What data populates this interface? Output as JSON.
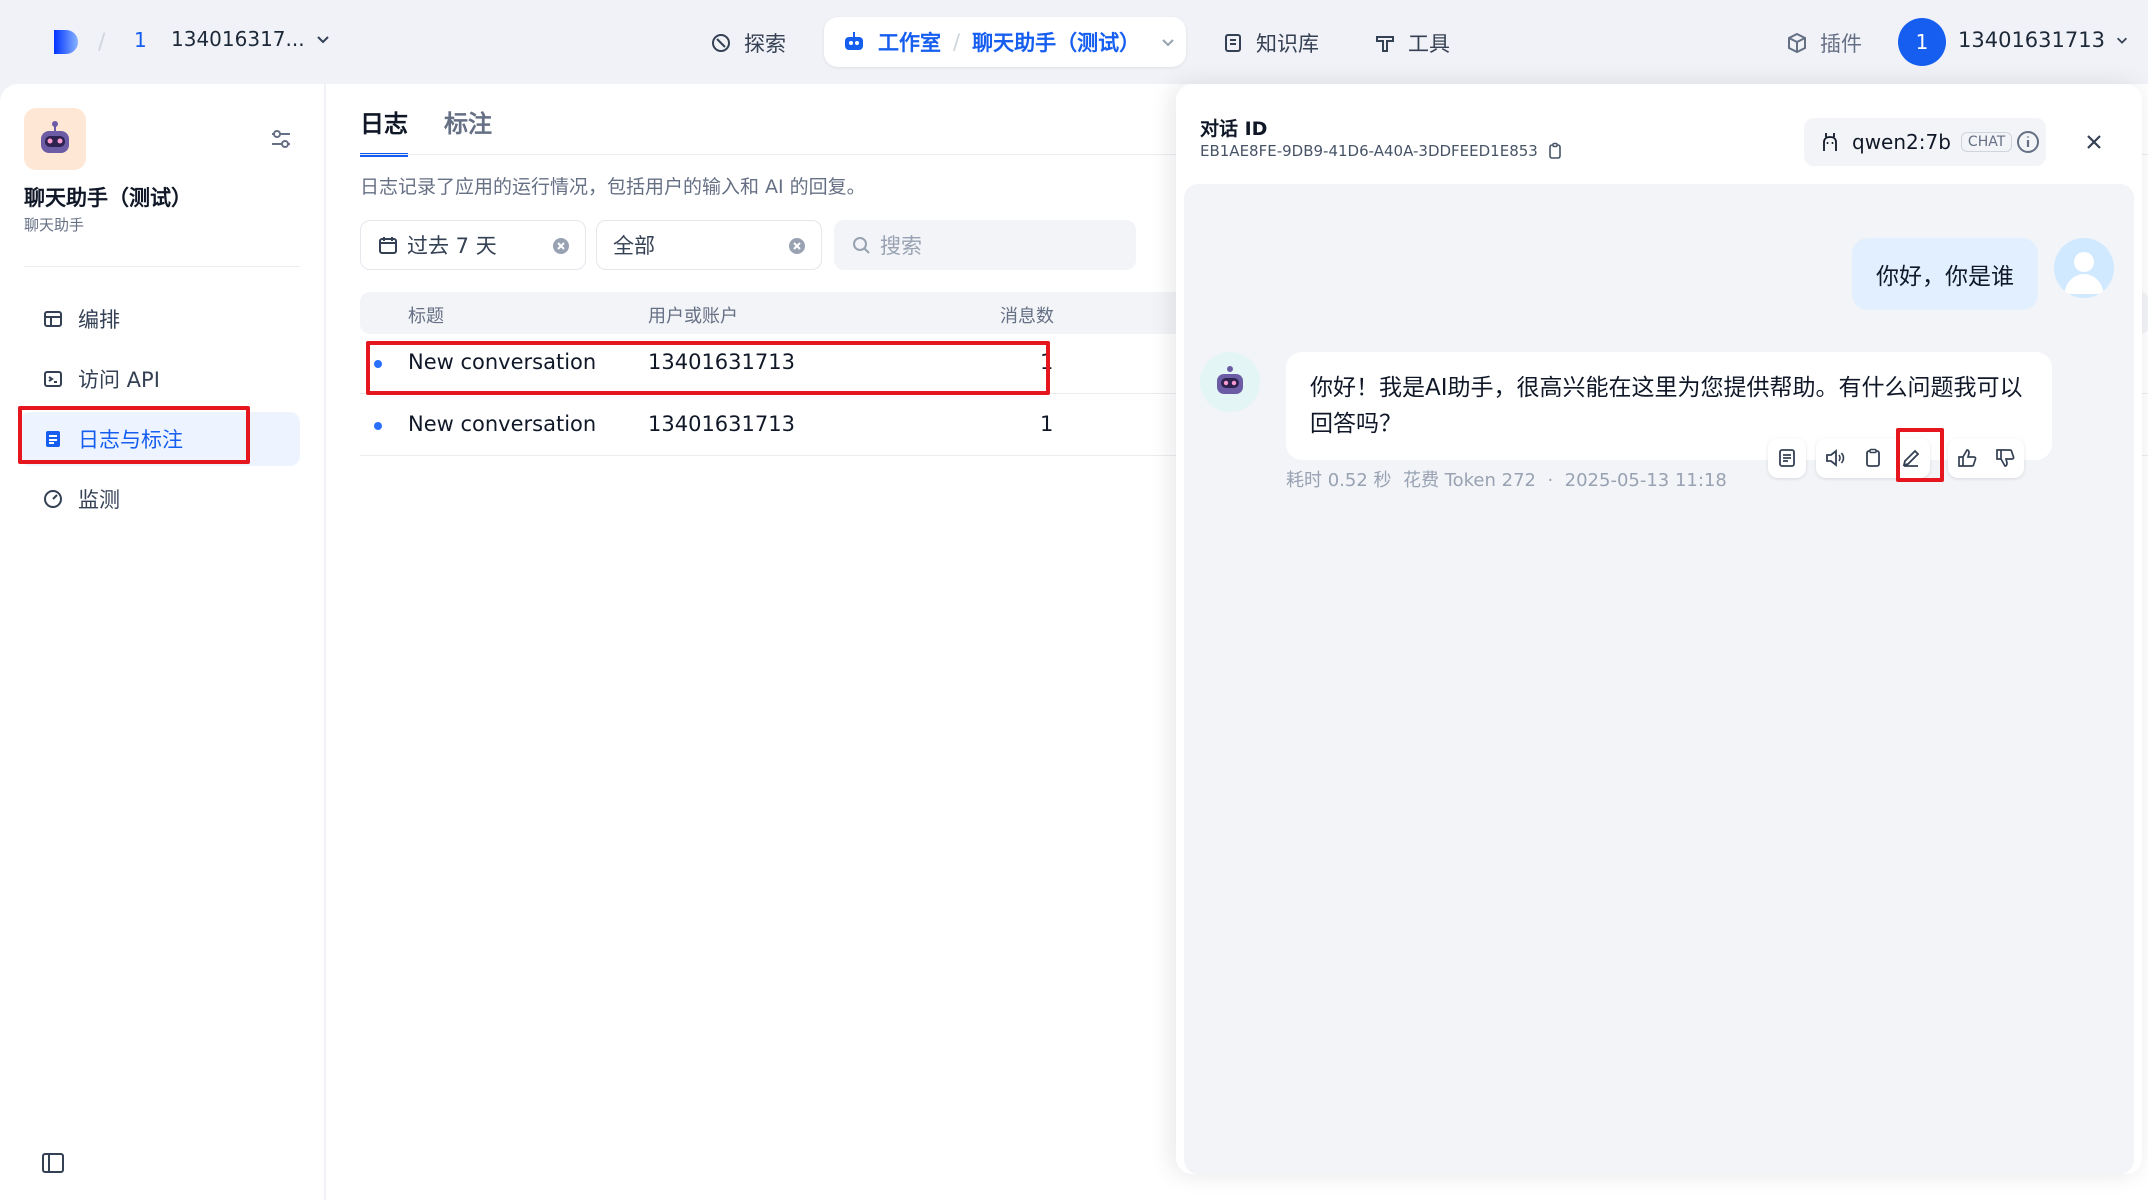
{
  "topbar": {
    "workspace_badge": "1",
    "workspace_name": "134016317...",
    "nav_explore": "探索",
    "nav_studio": "工作室",
    "nav_app": "聊天助手（测试）",
    "nav_knowledge": "知识库",
    "nav_tools": "工具",
    "nav_plugins": "插件",
    "user_avatar": "1",
    "user_name": "13401631713"
  },
  "sidebar": {
    "app_title": "聊天助手（测试）",
    "app_subtitle": "聊天助手",
    "items": [
      {
        "label": "编排"
      },
      {
        "label": "访问 API"
      },
      {
        "label": "日志与标注"
      },
      {
        "label": "监测"
      }
    ]
  },
  "main": {
    "tabs": [
      {
        "label": "日志"
      },
      {
        "label": "标注"
      }
    ],
    "description": "日志记录了应用的运行情况，包括用户的输入和 AI 的回复。",
    "filter_period": "过去 7 天",
    "filter_status": "全部",
    "search_placeholder": "搜索",
    "columns": [
      "标题",
      "用户或账户",
      "消息数"
    ],
    "rows": [
      {
        "title": "New conversation",
        "user": "13401631713",
        "count": "1"
      },
      {
        "title": "New conversation",
        "user": "13401631713",
        "count": "1"
      }
    ]
  },
  "drawer": {
    "conv_label": "对话 ID",
    "conv_id": "EB1AE8FE-9DB9-41D6-A40A-3DDFEED1E853",
    "model_name": "qwen2:7b",
    "model_tag": "CHAT",
    "user_message": "你好，你是谁",
    "bot_message": "你好！我是AI助手，很高兴能在这里为您提供帮助。有什么问题我可以回答吗？",
    "meta_time": "耗时 0.52 秒",
    "meta_tokens": "花费 Token 272",
    "meta_sep": "·",
    "meta_date": "2025-05-13 11:18"
  },
  "colors": {
    "accent": "#155eef",
    "highlight": "#e5161d",
    "active_bg": "#eef4ff"
  }
}
